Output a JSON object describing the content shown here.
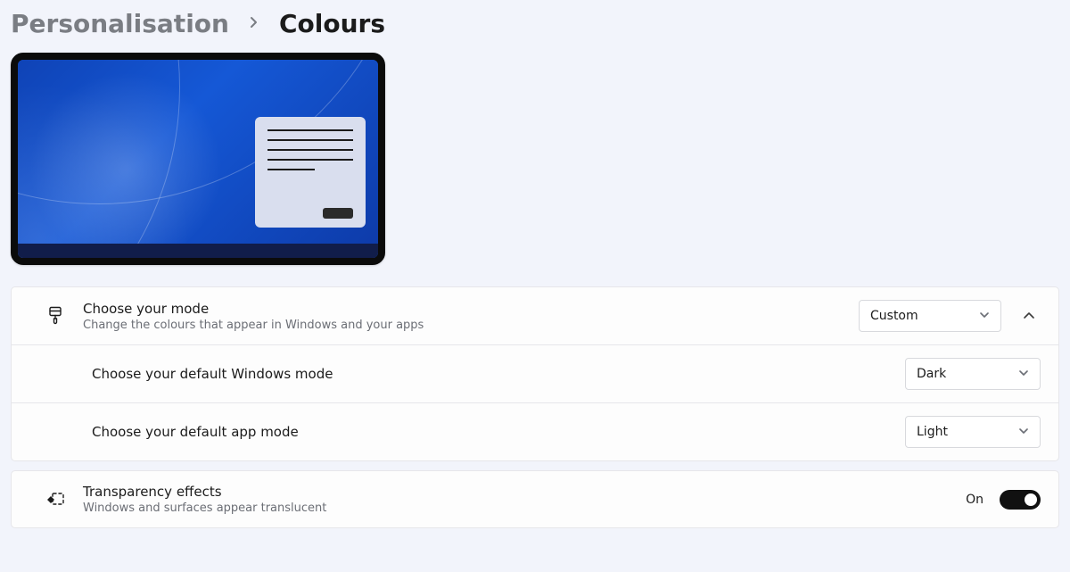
{
  "breadcrumb": {
    "parent": "Personalisation",
    "current": "Colours"
  },
  "sections": {
    "mode": {
      "title": "Choose your mode",
      "desc": "Change the colours that appear in Windows and your apps",
      "value": "Custom"
    },
    "windows_mode": {
      "title": "Choose your default Windows mode",
      "value": "Dark"
    },
    "app_mode": {
      "title": "Choose your default app mode",
      "value": "Light"
    },
    "transparency": {
      "title": "Transparency effects",
      "desc": "Windows and surfaces appear translucent",
      "state_label": "On"
    }
  }
}
